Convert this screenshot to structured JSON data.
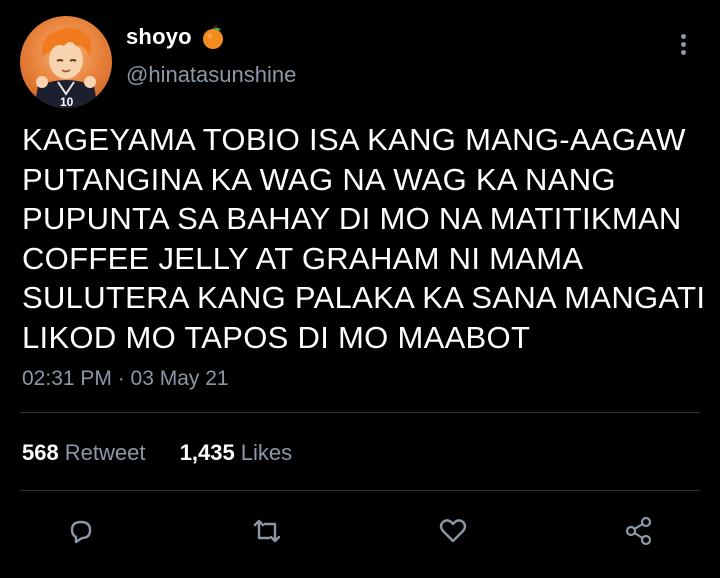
{
  "tweet": {
    "display_name": "shoyo",
    "handle": "@hinatasunshine",
    "lines": [
      "KAGEYAMA TOBIO ISA KANG MANG-AAGAW",
      "PUTANGINA KA WAG NA WAG KA NANG",
      "PUPUNTA SA BAHAY DI MO NA MATITIKMAN",
      "COFFEE JELLY AT GRAHAM NI MAMA",
      "SULUTERA KANG PALAKA KA SANA MANGATI",
      "LIKOD MO TAPOS DI MO MAABOT"
    ],
    "timestamp": "02:31 PM · 03 May 21",
    "stats": {
      "retweets_count": "568",
      "retweets_label": "Retweet",
      "likes_count": "1,435",
      "likes_label": "Likes"
    }
  },
  "icons": {
    "name_emoji": "orange-icon",
    "more": "more-vertical-icon",
    "reply": "reply-icon",
    "retweet": "retweet-icon",
    "like": "heart-icon",
    "share": "share-icon"
  },
  "colors": {
    "background": "#000000",
    "text": "#ffffff",
    "secondary": "#8b98a5",
    "divider": "#2f3336"
  }
}
